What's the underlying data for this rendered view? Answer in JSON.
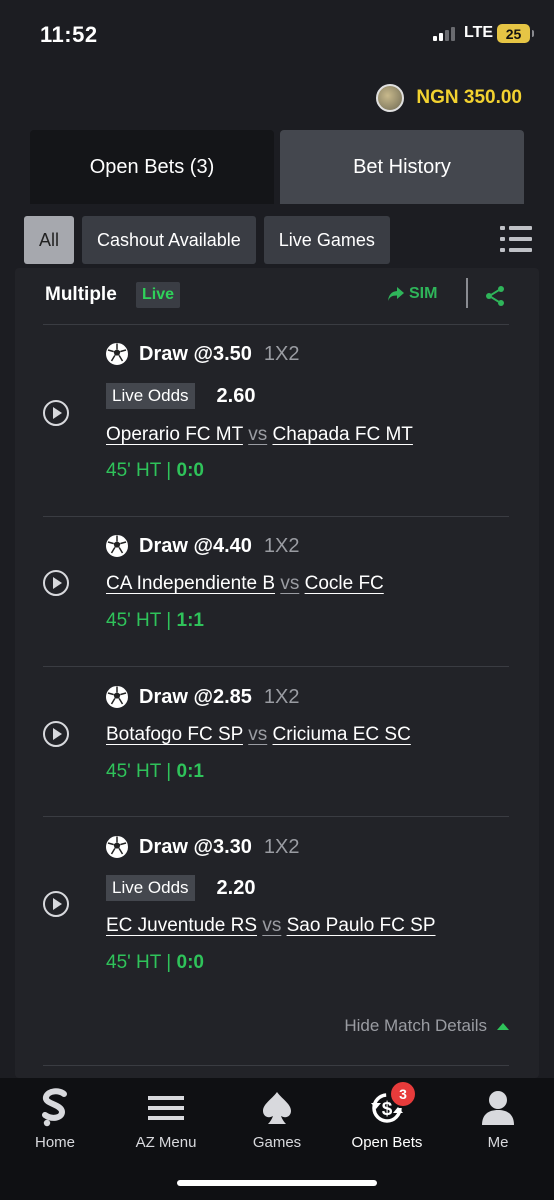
{
  "status_bar": {
    "time": "11:52",
    "network": "LTE",
    "battery": "25"
  },
  "balance": {
    "amount": "NGN 350.00"
  },
  "tabs": [
    {
      "label": "Open Bets (3)",
      "active": true
    },
    {
      "label": "Bet History",
      "active": false
    }
  ],
  "filters": [
    {
      "label": "All",
      "active": true
    },
    {
      "label": "Cashout Available",
      "active": false
    },
    {
      "label": "Live Games",
      "active": false
    }
  ],
  "bet": {
    "title": "Multiple",
    "live_label": "Live",
    "sim_label": "SIM",
    "matches": [
      {
        "selection": "Draw @3.50",
        "market": "1X2",
        "live_odds_label": "Live Odds",
        "live_odds": "2.60",
        "home": "Operario FC MT",
        "vs": "vs",
        "away": "Chapada FC MT",
        "time": "45' HT | ",
        "score": "0:0"
      },
      {
        "selection": "Draw @4.40",
        "market": "1X2",
        "home": "CA Independiente B",
        "vs": "vs",
        "away": "Cocle FC",
        "time": "45' HT | ",
        "score": "1:1"
      },
      {
        "selection": "Draw @2.85",
        "market": "1X2",
        "home": "Botafogo FC SP",
        "vs": "vs",
        "away": "Criciuma EC SC",
        "time": "45' HT | ",
        "score": "0:1"
      },
      {
        "selection": "Draw @3.30",
        "market": "1X2",
        "live_odds_label": "Live Odds",
        "live_odds": "2.20",
        "home": "EC Juventude RS",
        "vs": "vs",
        "away": "Sao Paulo FC SP",
        "time": "45' HT | ",
        "score": "0:0"
      }
    ],
    "hide_details": "Hide Match Details"
  },
  "nav": [
    {
      "label": "Home",
      "icon": "sporty-logo-icon"
    },
    {
      "label": "AZ Menu",
      "icon": "menu-icon"
    },
    {
      "label": "Games",
      "icon": "spade-icon"
    },
    {
      "label": "Open Bets",
      "icon": "open-bets-icon",
      "badge": "3",
      "active": true
    },
    {
      "label": "Me",
      "icon": "person-icon"
    }
  ],
  "colors": {
    "accent_green": "#2fc35a",
    "balance_yellow": "#f2d230",
    "badge_red": "#e73b3b",
    "background": "#1c1d22"
  }
}
